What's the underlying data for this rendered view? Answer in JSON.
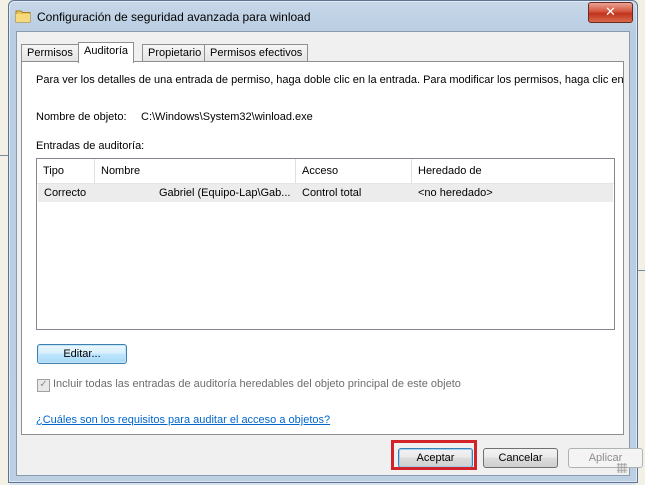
{
  "window": {
    "title": "Configuración de seguridad avanzada para winload",
    "close_glyph": "✕"
  },
  "tabs": [
    {
      "label": "Permisos",
      "active": false
    },
    {
      "label": "Auditoría",
      "active": true
    },
    {
      "label": "Propietario",
      "active": false
    },
    {
      "label": "Permisos efectivos",
      "active": false
    }
  ],
  "panel": {
    "description": "Para ver los detalles de una entrada de permiso, haga doble clic en la entrada. Para modificar los permisos, haga clic en",
    "object_name_label": "Nombre de objeto:",
    "object_name_value": "C:\\Windows\\System32\\winload.exe",
    "entries_label": "Entradas de auditoría:",
    "columns": [
      "Tipo",
      "Nombre",
      "Acceso",
      "Heredado de"
    ],
    "rows": [
      {
        "tipo": "Correcto",
        "nombre": "Gabriel (Equipo-Lap\\Gab...",
        "acceso": "Control total",
        "heredado": "<no heredado>"
      }
    ],
    "edit_button": "Editar...",
    "include_checkbox_label": "Incluir todas las entradas de auditoría heredables del objeto principal de este objeto",
    "include_checked": true,
    "help_link": "¿Cuáles son los requisitos para auditar el acceso a objetos?"
  },
  "buttons": {
    "ok": "Aceptar",
    "cancel": "Cancelar",
    "apply": "Aplicar"
  },
  "colors": {
    "highlight": "#d2232a",
    "link": "#0066cc"
  }
}
